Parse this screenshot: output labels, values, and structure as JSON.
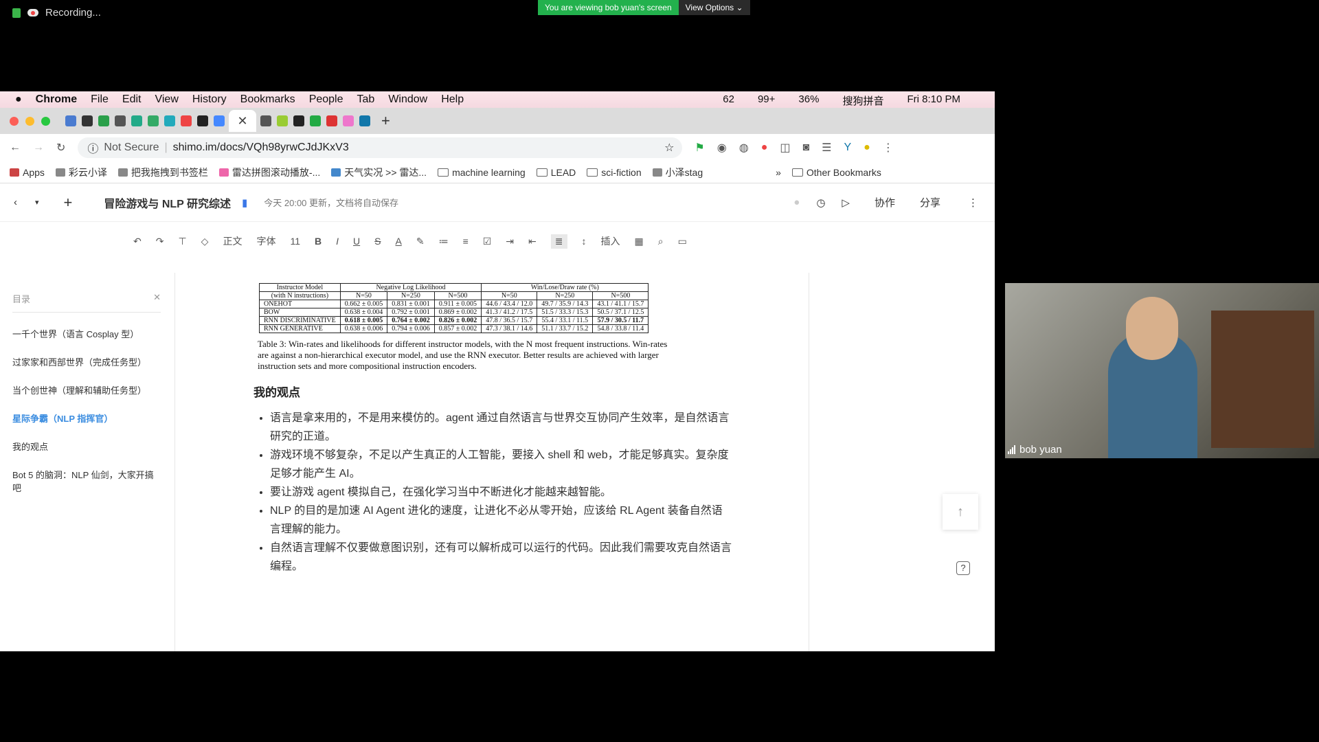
{
  "zoom": {
    "recording_label": "Recording...",
    "viewing_banner": "You are viewing bob yuan's screen",
    "view_options": "View Options ⌄",
    "participant_name": "bob yuan"
  },
  "macmenu": {
    "apple": "",
    "app": "Chrome",
    "items": [
      "File",
      "Edit",
      "View",
      "History",
      "Bookmarks",
      "People",
      "Tab",
      "Window",
      "Help"
    ],
    "status": [
      "62",
      "99+",
      "36%",
      "搜狗拼音",
      "Fri 8:10 PM"
    ]
  },
  "browser": {
    "security": "Not Secure",
    "url": "shimo.im/docs/VQh98yrwCJdJKxV3",
    "bookmarks": [
      "Apps",
      "彩云小译",
      "把我拖拽到书签栏",
      "雷达拼图滚动播放-...",
      "天气实况 >> 雷达...",
      "machine learning",
      "LEAD",
      "sci-fiction",
      "小泽stag",
      "Other Bookmarks"
    ]
  },
  "doc": {
    "title": "冒险游戏与 NLP 研究综述",
    "status": "今天 20:00 更新，文档将自动保存",
    "collab": "协作",
    "share": "分享"
  },
  "toolbar": {
    "style": "正文",
    "font": "字体",
    "size": "11",
    "insert": "插入"
  },
  "toc": {
    "header": "目录",
    "items": [
      "一千个世界（语言 Cosplay 型）",
      "过家家和西部世界（完成任务型）",
      "当个创世神（理解和辅助任务型）",
      "星际争霸（NLP 指挥官）",
      "我的观点",
      "Bot 5 的脑洞：NLP 仙剑，大家开搞吧"
    ],
    "active_index": 3
  },
  "table": {
    "h1": [
      "Instructor Model",
      "Negative Log Likelihood",
      "Win/Lose/Draw rate (%)"
    ],
    "h2": [
      "(with N instructions)",
      "N=50",
      "N=250",
      "N=500",
      "N=50",
      "N=250",
      "N=500"
    ],
    "rows": [
      [
        "ONEHOT",
        "0.662 ± 0.005",
        "0.831 ± 0.001",
        "0.911 ± 0.005",
        "44.6 / 43.4 / 12.0",
        "49.7 / 35.9 / 14.3",
        "43.1 / 41.1 / 15.7"
      ],
      [
        "BOW",
        "0.638 ± 0.004",
        "0.792 ± 0.001",
        "0.869 ± 0.002",
        "41.3 / 41.2 / 17.5",
        "51.5 / 33.3 / 15.3",
        "50.5 / 37.1 / 12.5"
      ],
      [
        "RNN DISCRIMINATIVE",
        "0.618 ± 0.005",
        "0.764 ± 0.002",
        "0.826 ± 0.002",
        "47.8 / 36.5 / 15.7",
        "55.4 / 33.1 / 11.5",
        "57.9 / 30.5 / 11.7"
      ],
      [
        "RNN GENERATIVE",
        "0.638 ± 0.006",
        "0.794 ± 0.006",
        "0.857 ± 0.002",
        "47.3 / 38.1 / 14.6",
        "51.1 / 33.7 / 15.2",
        "54.8 / 33.8 / 11.4"
      ]
    ],
    "caption": "Table 3:  Win-rates and likelihoods for different instructor models, with the N most frequent instructions. Win-rates are against a non-hierarchical executor model, and use the RNN executor. Better results are achieved with larger instruction sets and more compositional instruction encoders."
  },
  "section_title": "我的观点",
  "bullets": [
    "语言是拿来用的，不是用来模仿的。agent 通过自然语言与世界交互协同产生效率，是自然语言研究的正道。",
    "游戏环境不够复杂，不足以产生真正的人工智能，要接入 shell 和 web，才能足够真实。复杂度足够才能产生 AI。",
    "要让游戏 agent 模拟自己，在强化学习当中不断进化才能越来越智能。",
    "NLP 的目的是加速 AI Agent 进化的速度，让进化不必从零开始，应该给 RL Agent 装备自然语言理解的能力。",
    "自然语言理解不仅要做意图识别，还有可以解析成可以运行的代码。因此我们需要攻克自然语言编程。"
  ]
}
